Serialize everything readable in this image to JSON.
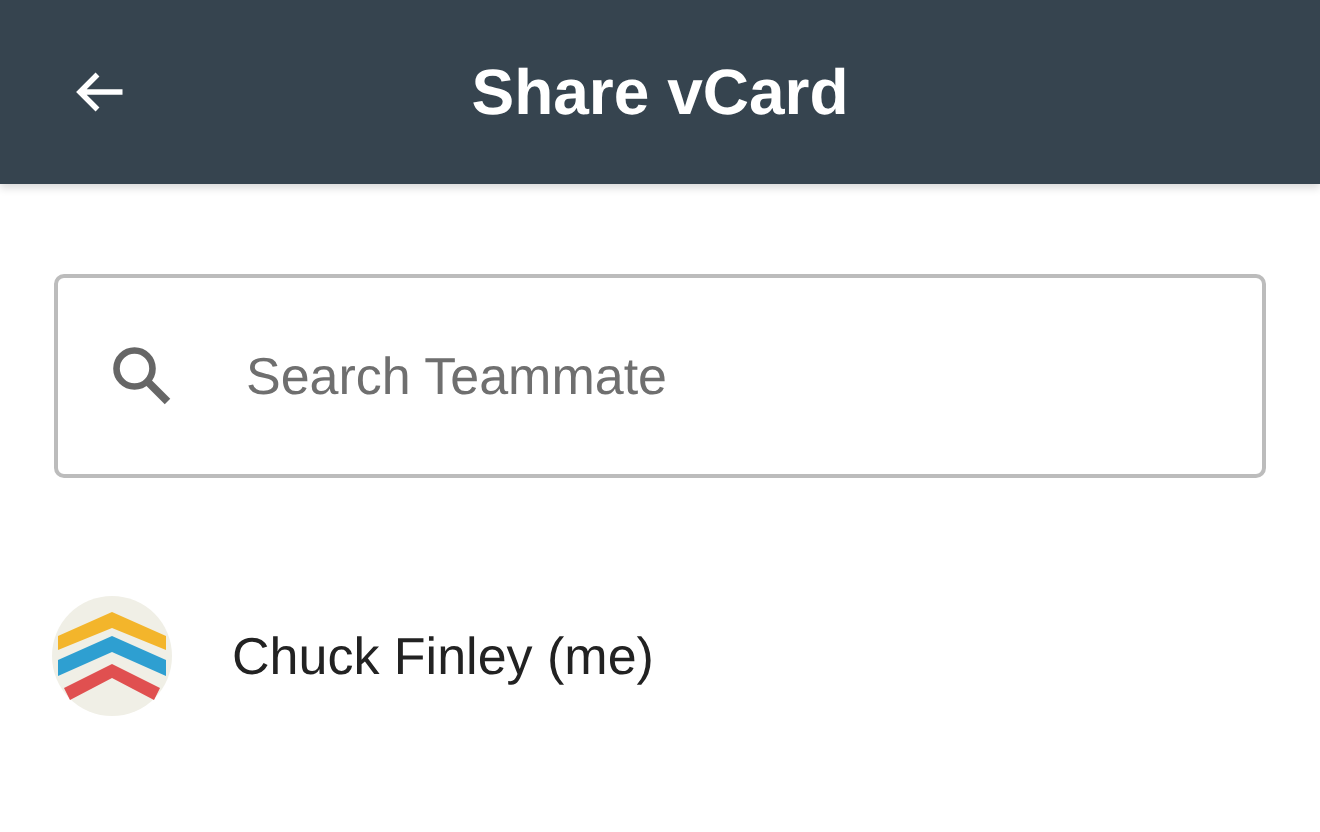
{
  "header": {
    "title": "Share vCard"
  },
  "search": {
    "placeholder": "Search Teammate"
  },
  "teammates": [
    {
      "name": "Chuck Finley (me)"
    }
  ]
}
